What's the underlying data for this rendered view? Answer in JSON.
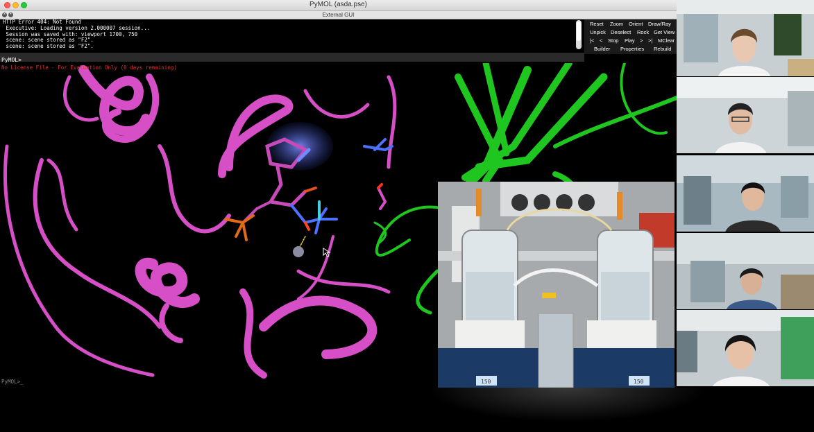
{
  "window": {
    "title": "PyMOL (asda.pse)",
    "subtitle": "External GUI"
  },
  "log": [
    "HTTP Error 404: Not Found",
    " Executive: Loading version 2.000007 session...",
    " Session was saved with: viewport 1700, 750",
    " scene: scene stored as \"F2\".",
    " scene: scene stored as \"F2\"."
  ],
  "command_prompt": "PyMOL>",
  "bottom_prompt": "PyMOL>_",
  "buttons": {
    "row1": [
      "Reset",
      "Zoom",
      "Orient",
      "Draw/Ray"
    ],
    "row2": [
      "Unpick",
      "Deselect",
      "Rock",
      "Get View"
    ],
    "row3": [
      "|<",
      "<",
      "Stop",
      "Play",
      ">",
      ">|",
      "MClear"
    ],
    "row4": [
      "Builder",
      "Properties",
      "Rebuild"
    ]
  },
  "viewport": {
    "license": "No License File - For Evaluation Only (0 days remaining)"
  },
  "lab_display": {
    "left_value": "150",
    "right_value": "150"
  },
  "colors": {
    "cartoon_pink": "#d64fc6",
    "cartoon_green": "#22cc22",
    "log_text": "#ffffff",
    "license_text": "#e03030"
  },
  "participants": [
    "participant-1",
    "participant-2",
    "participant-3",
    "participant-4",
    "participant-5"
  ]
}
